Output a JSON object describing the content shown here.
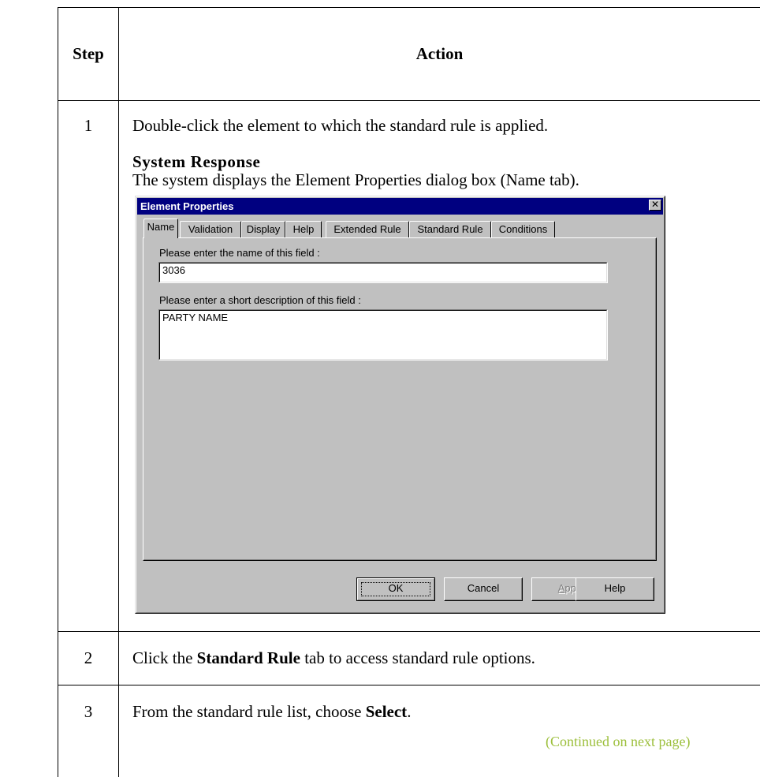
{
  "table": {
    "header_step": "Step",
    "header_action": "Action"
  },
  "rows": [
    {
      "step": "1",
      "text": "Double-click the element to which the standard rule is applied."
    },
    {
      "step": "2",
      "pre": "Click the ",
      "bold": "Standard Rule",
      "post": " tab to access standard rule options."
    },
    {
      "step": "3",
      "pre": "From the standard rule list, choose ",
      "bold": "Select",
      "post": "."
    }
  ],
  "system_response": {
    "heading": "System Response",
    "text": "The system displays the Element Properties dialog box (Name tab)."
  },
  "dialog": {
    "title": "Element Properties",
    "close_glyph": "✕",
    "tabs": [
      "Name",
      "Validation",
      "Display",
      "Help",
      "Extended Rule",
      "Standard Rule",
      "Conditions"
    ],
    "active_tab": "Name",
    "name_label": "Please enter the name of this field :",
    "name_value": "3036",
    "desc_label": "Please enter a short description of this field :",
    "desc_value": "PARTY NAME",
    "buttons": {
      "ok": "OK",
      "cancel": "Cancel",
      "apply_first": "A",
      "apply_rest": "pply",
      "help": "Help"
    }
  },
  "footer": {
    "continued": "(Continued on next page)",
    "continued_color": "#9cbf3b"
  }
}
